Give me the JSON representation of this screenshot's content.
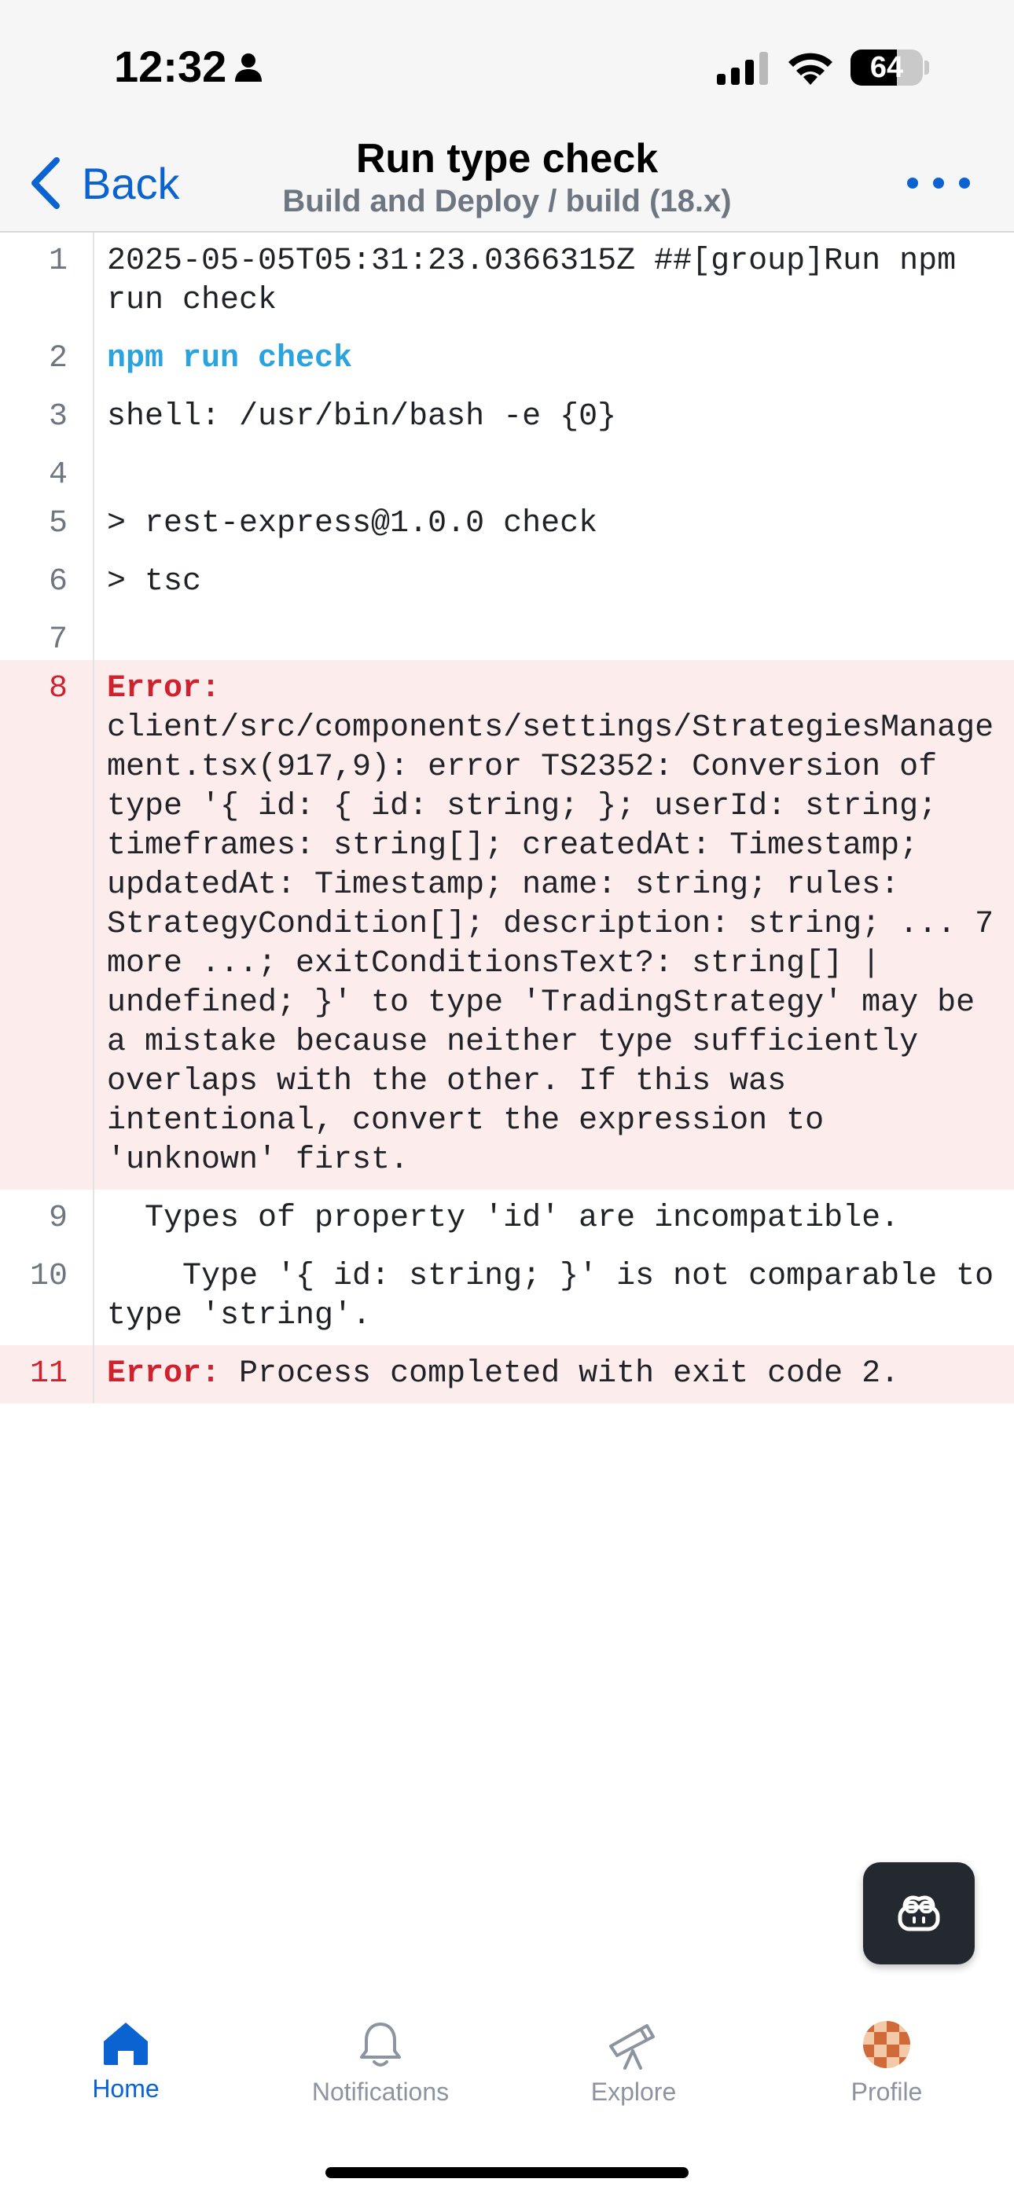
{
  "status_bar": {
    "time": "12:32",
    "battery_percent": "64",
    "battery_level": 0.64,
    "icons": [
      "person-icon",
      "cellular-signal-icon",
      "wifi-icon",
      "battery-icon"
    ]
  },
  "nav": {
    "back_label": "Back",
    "title": "Run type check",
    "subtitle": "Build and Deploy / build (18.x)",
    "more_icon": "more-horizontal-icon"
  },
  "log": {
    "error_prefix": "Error:",
    "lines": [
      {
        "number": "1",
        "text": "2025-05-05T05:31:23.0366315Z ##[group]Run npm run check"
      },
      {
        "number": "2",
        "text": "npm run check"
      },
      {
        "number": "3",
        "text": "shell: /usr/bin/bash -e {0}"
      },
      {
        "number": "4",
        "text": ""
      },
      {
        "number": "5",
        "text": "> rest-express@1.0.0 check"
      },
      {
        "number": "6",
        "text": "> tsc"
      },
      {
        "number": "7",
        "text": ""
      },
      {
        "number": "8",
        "text": " client/src/components/settings/StrategiesManagement.tsx(917,9): error TS2352: Conversion of type '{ id: { id: string; }; userId: string; timeframes: string[]; createdAt: Timestamp; updatedAt: Timestamp; name: string; rules: StrategyCondition[]; description: string; ... 7 more ...; exitConditionsText?: string[] | undefined; }' to type 'TradingStrategy' may be a mistake because neither type sufficiently overlaps with the other. If this was intentional, convert the expression to 'unknown' first."
      },
      {
        "number": "9",
        "text": "  Types of property 'id' are incompatible."
      },
      {
        "number": "10",
        "text": "    Type '{ id: string; }' is not comparable to type 'string'."
      },
      {
        "number": "11",
        "text": " Process completed with exit code 2."
      }
    ]
  },
  "copilot": {
    "icon": "copilot-icon"
  },
  "tabs": [
    {
      "label": "Home",
      "icon": "home-icon"
    },
    {
      "label": "Notifications",
      "icon": "bell-icon"
    },
    {
      "label": "Explore",
      "icon": "telescope-icon"
    },
    {
      "label": "Profile",
      "icon": "avatar-icon"
    }
  ],
  "colors": {
    "accent": "#0a63d1",
    "error": "#cf222e",
    "error_bg": "#fdecec",
    "command": "#2aa3de"
  }
}
